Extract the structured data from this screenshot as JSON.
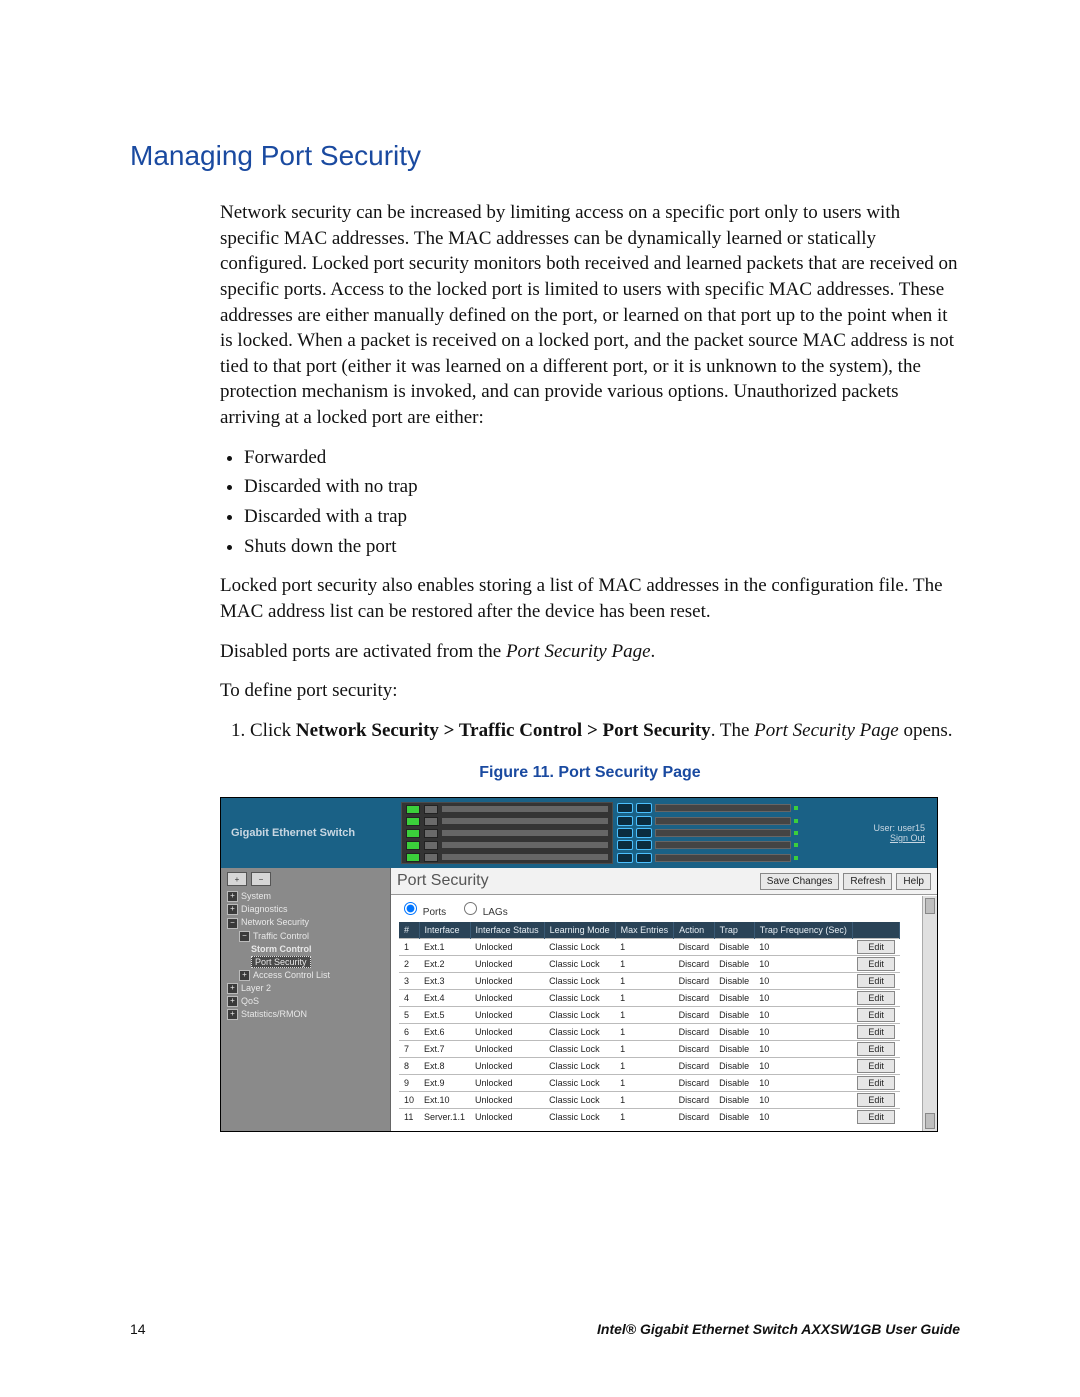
{
  "heading": "Managing Port Security",
  "intro": "Network security can be increased by limiting access on a specific port only to users with specific MAC addresses. The MAC addresses can be dynamically learned or statically configured. Locked port security monitors both received and learned packets that are received on specific ports. Access to the locked port is limited to users with specific MAC addresses. These addresses are either manually defined on the port, or learned on that port up to the point when it is locked. When a packet is received on a locked port, and the packet source MAC address is not tied to that port (either it was learned on a different port, or it is unknown to the system), the protection mechanism is invoked, and can provide various options. Unauthorized packets arriving at a locked port are either:",
  "bullets": [
    "Forwarded",
    "Discarded with no trap",
    "Discarded with a trap",
    "Shuts down the port"
  ],
  "after_bullets": "Locked port security also enables storing a list of MAC addresses in the configuration file. The MAC address list can be restored after the device has been reset.",
  "disabled_line_pre": "Disabled ports are activated from the ",
  "disabled_line_em": "Port Security Page",
  "disabled_line_post": ".",
  "define_line": "To define port security:",
  "step1_pre": "Click ",
  "step1_bold": "Network Security > Traffic Control > Port Security",
  "step1_mid": ". The ",
  "step1_em": "Port Security Page",
  "step1_post": " opens.",
  "figure_caption": "Figure 11. Port Security Page",
  "footer": {
    "page": "14",
    "guide": "Intel® Gigabit Ethernet Switch AXXSW1GB User Guide"
  },
  "shot": {
    "brand": "Gigabit Ethernet Switch",
    "user_label": "User: user15",
    "signout": "Sign Out",
    "title": "Port Security",
    "buttons": {
      "save": "Save Changes",
      "refresh": "Refresh",
      "help": "Help"
    },
    "radios": {
      "ports": "Ports",
      "lags": "LAGs"
    },
    "tree": {
      "btn_expand": "+",
      "btn_collapse": "−",
      "n0": "System",
      "n1": "Diagnostics",
      "n2": "Network Security",
      "n2a": "Traffic Control",
      "n2a1": "Storm Control",
      "n2a2": "Port Security",
      "n2b": "Access Control List",
      "n3": "Layer 2",
      "n4": "QoS",
      "n5": "Statistics/RMON"
    },
    "headers": [
      "#",
      "Interface",
      "Interface Status",
      "Learning Mode",
      "Max Entries",
      "Action",
      "Trap",
      "Trap Frequency (Sec)",
      ""
    ],
    "rows": [
      {
        "n": "1",
        "if": "Ext.1",
        "st": "Unlocked",
        "lm": "Classic Lock",
        "me": "1",
        "ac": "Discard",
        "tr": "Disable",
        "tf": "10",
        "edit": "Edit"
      },
      {
        "n": "2",
        "if": "Ext.2",
        "st": "Unlocked",
        "lm": "Classic Lock",
        "me": "1",
        "ac": "Discard",
        "tr": "Disable",
        "tf": "10",
        "edit": "Edit"
      },
      {
        "n": "3",
        "if": "Ext.3",
        "st": "Unlocked",
        "lm": "Classic Lock",
        "me": "1",
        "ac": "Discard",
        "tr": "Disable",
        "tf": "10",
        "edit": "Edit"
      },
      {
        "n": "4",
        "if": "Ext.4",
        "st": "Unlocked",
        "lm": "Classic Lock",
        "me": "1",
        "ac": "Discard",
        "tr": "Disable",
        "tf": "10",
        "edit": "Edit"
      },
      {
        "n": "5",
        "if": "Ext.5",
        "st": "Unlocked",
        "lm": "Classic Lock",
        "me": "1",
        "ac": "Discard",
        "tr": "Disable",
        "tf": "10",
        "edit": "Edit"
      },
      {
        "n": "6",
        "if": "Ext.6",
        "st": "Unlocked",
        "lm": "Classic Lock",
        "me": "1",
        "ac": "Discard",
        "tr": "Disable",
        "tf": "10",
        "edit": "Edit"
      },
      {
        "n": "7",
        "if": "Ext.7",
        "st": "Unlocked",
        "lm": "Classic Lock",
        "me": "1",
        "ac": "Discard",
        "tr": "Disable",
        "tf": "10",
        "edit": "Edit"
      },
      {
        "n": "8",
        "if": "Ext.8",
        "st": "Unlocked",
        "lm": "Classic Lock",
        "me": "1",
        "ac": "Discard",
        "tr": "Disable",
        "tf": "10",
        "edit": "Edit"
      },
      {
        "n": "9",
        "if": "Ext.9",
        "st": "Unlocked",
        "lm": "Classic Lock",
        "me": "1",
        "ac": "Discard",
        "tr": "Disable",
        "tf": "10",
        "edit": "Edit"
      },
      {
        "n": "10",
        "if": "Ext.10",
        "st": "Unlocked",
        "lm": "Classic Lock",
        "me": "1",
        "ac": "Discard",
        "tr": "Disable",
        "tf": "10",
        "edit": "Edit"
      },
      {
        "n": "11",
        "if": "Server.1.1",
        "st": "Unlocked",
        "lm": "Classic Lock",
        "me": "1",
        "ac": "Discard",
        "tr": "Disable",
        "tf": "10",
        "edit": "Edit"
      }
    ]
  }
}
